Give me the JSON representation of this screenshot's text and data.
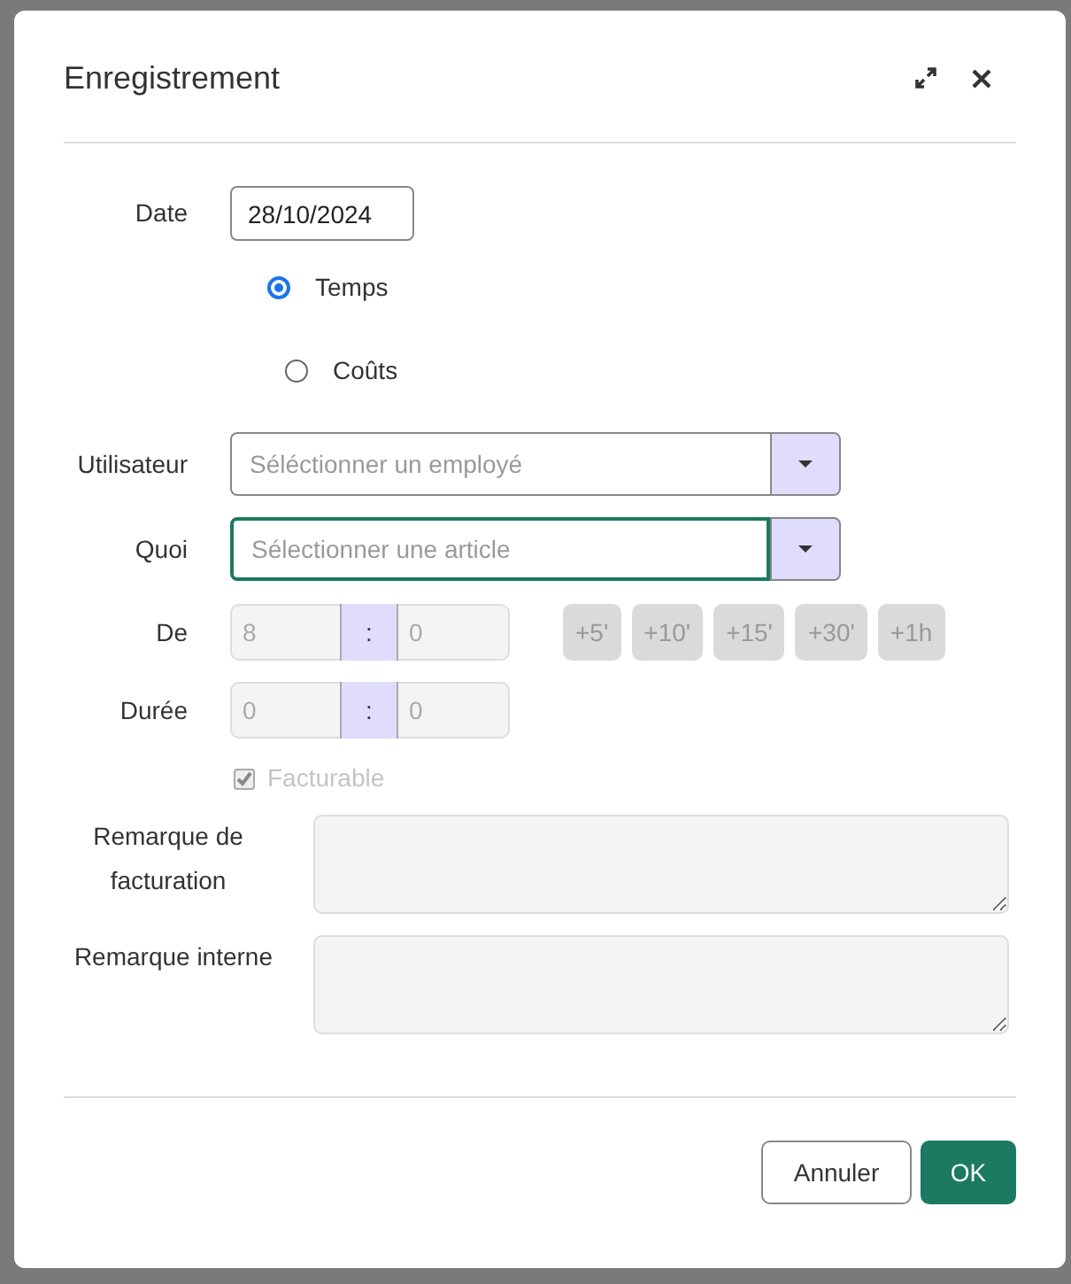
{
  "dialog": {
    "title": "Enregistrement",
    "date": {
      "label": "Date",
      "value": "28/10/2024"
    },
    "entry_type": [
      {
        "label": "Temps",
        "selected": true
      },
      {
        "label": "Coûts",
        "selected": false
      }
    ],
    "user": {
      "label": "Utilisateur",
      "placeholder": "Séléctionner un employé",
      "focused": false
    },
    "what": {
      "label": "Quoi",
      "placeholder": "Sélectionner une article",
      "focused": true
    },
    "from": {
      "label": "De",
      "hours": "8",
      "minutes": "0",
      "separator": ":"
    },
    "increments": [
      "+5'",
      "+10'",
      "+15'",
      "+30'",
      "+1h"
    ],
    "duration": {
      "label": "Durée",
      "hours": "0",
      "minutes": "0",
      "separator": ":"
    },
    "billable": {
      "label": "Facturable",
      "checked": true,
      "disabled": true
    },
    "billing_note": {
      "label": "Remarque de facturation"
    },
    "internal_note": {
      "label": "Remarque interne"
    },
    "buttons": [
      {
        "label": "Annuler",
        "kind": "secondary"
      },
      {
        "label": "OK",
        "kind": "primary"
      }
    ]
  }
}
